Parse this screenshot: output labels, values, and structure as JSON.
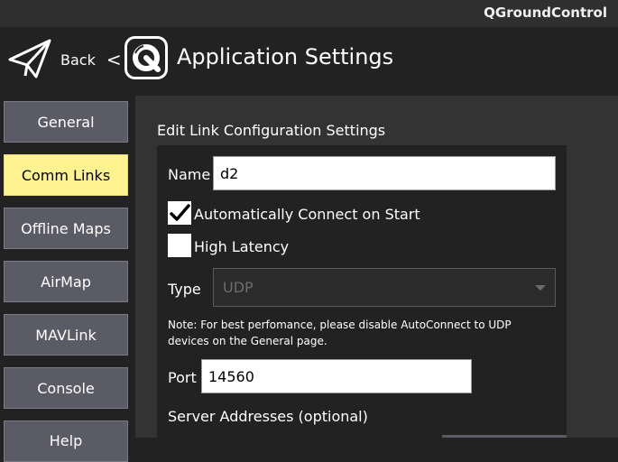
{
  "window": {
    "title": "QGroundControl"
  },
  "header": {
    "back_label": "Back",
    "back_chevron": "<",
    "title": "Application Settings",
    "plane_icon": "paper-plane-icon",
    "logo_icon": "qgc-logo-icon"
  },
  "sidebar": {
    "items": [
      {
        "label": "General",
        "active": false
      },
      {
        "label": "Comm Links",
        "active": true
      },
      {
        "label": "Offline Maps",
        "active": false
      },
      {
        "label": "AirMap",
        "active": false
      },
      {
        "label": "MAVLink",
        "active": false
      },
      {
        "label": "Console",
        "active": false
      },
      {
        "label": "Help",
        "active": false
      }
    ]
  },
  "main": {
    "section_title": "Edit Link Configuration Settings",
    "name_label": "Name",
    "name_value": "d2",
    "auto_connect": {
      "label": "Automatically Connect on Start",
      "checked": true
    },
    "high_latency": {
      "label": "High Latency",
      "checked": false
    },
    "type_label": "Type",
    "type_value": "UDP",
    "note": "Note: For best perfomance, please disable AutoConnect to UDP devices on the General page.",
    "port_label": "Port",
    "port_value": "14560",
    "server_addresses_label": "Server Addresses (optional)"
  },
  "colors": {
    "active_tab": "#fff291",
    "button": "#5b5b66",
    "background": "#222222",
    "content_bg": "#333333"
  }
}
